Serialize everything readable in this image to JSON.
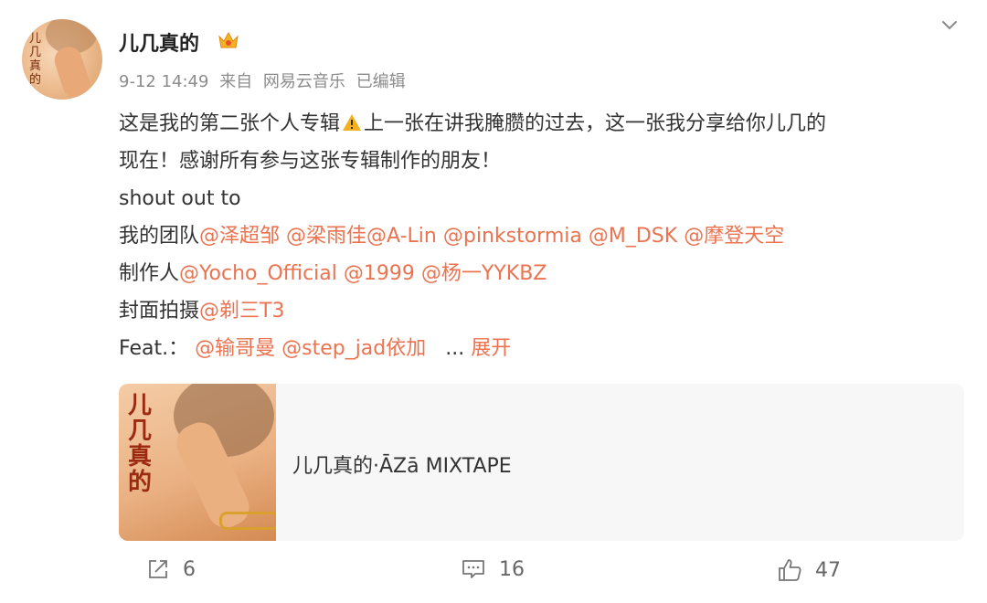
{
  "post": {
    "username": "儿几真的",
    "time": "9-12 14:49",
    "source_prefix": "来自",
    "source": "网易云音乐",
    "edited": "已编辑",
    "line1_a": "这是我的第二张个人专辑",
    "line1_b": "上一张在讲我腌臜的过去，这一张我分享给你儿几的",
    "line2": "现在！感谢所有参与这张专辑制作的朋友！",
    "line3": "shout out to",
    "team_label": "我的团队",
    "team_mentions": [
      "@泽超邹",
      "@梁雨佳",
      "@A-Lin",
      "@pinkstormia",
      "@M_DSK",
      "@摩登天空"
    ],
    "producer_label": "制作人",
    "producer_mentions": [
      "@Yocho_Official",
      "@1999",
      "@杨一YYKBZ"
    ],
    "cover_label": "封面拍摄",
    "cover_mentions": [
      "@剃三T3"
    ],
    "feat_label": "Feat.：",
    "feat_mentions": [
      "@输哥曼",
      "@step_jad依加"
    ],
    "ellipsis": "...",
    "expand": "展开"
  },
  "card": {
    "title": "儿几真的·ĀZā MIXTAPE",
    "cover_text": "儿几真的"
  },
  "actions": {
    "share_count": "6",
    "comment_count": "16",
    "like_count": "47"
  },
  "icons": [
    "crown-icon",
    "chevron-down-icon",
    "warning-icon",
    "share-icon",
    "comment-icon",
    "like-icon"
  ],
  "colors": {
    "mention": "#eb7350",
    "meta": "#8c8c8c",
    "text": "#333333"
  }
}
